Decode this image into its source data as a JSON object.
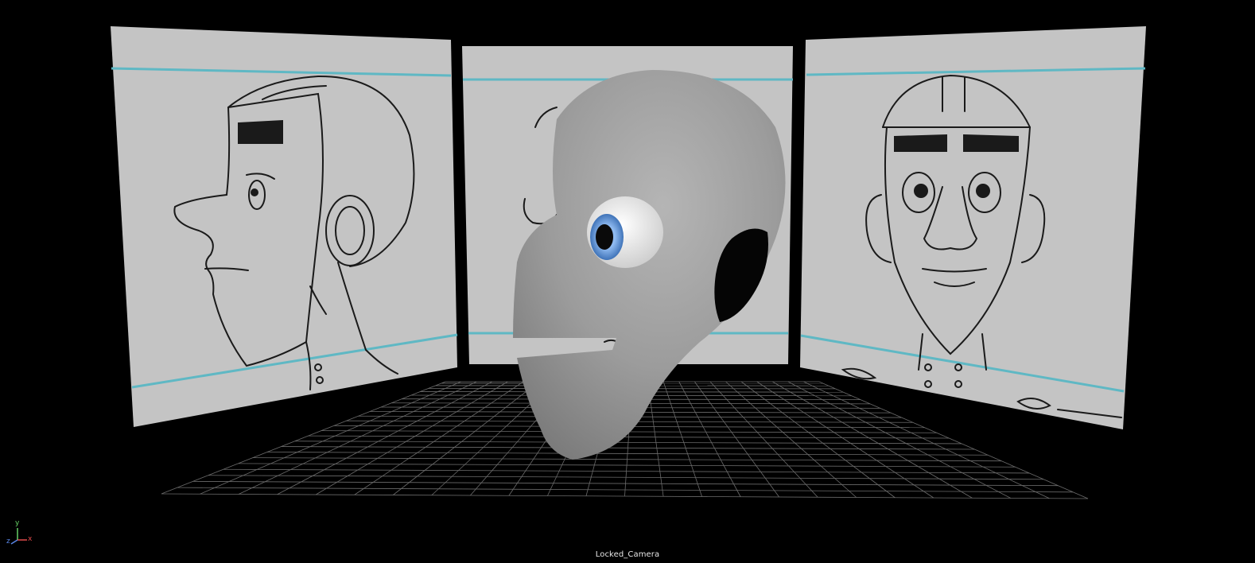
{
  "viewport": {
    "camera_name": "Locked_Camera",
    "background_color": "#000000",
    "grid_line_color": "#6b6b6b",
    "guide_line_color": "#5fb8c4",
    "image_plane_color": "#c4c4c4",
    "model_color": "#9a9a9a"
  },
  "axis_gizmo": {
    "y_label": "y",
    "x_label": "x",
    "z_label": "z",
    "y_color": "#66d166",
    "x_color": "#e04a4a",
    "z_color": "#5a86e6"
  },
  "image_planes": [
    {
      "name": "side-reference",
      "view": "side"
    },
    {
      "name": "three-quarter-reference",
      "view": "three-quarter"
    },
    {
      "name": "front-reference",
      "view": "front"
    }
  ],
  "model": {
    "name": "head-mesh",
    "eye_iris_color": "#6c9ed8",
    "eye_pupil_color": "#0a0a0a"
  }
}
